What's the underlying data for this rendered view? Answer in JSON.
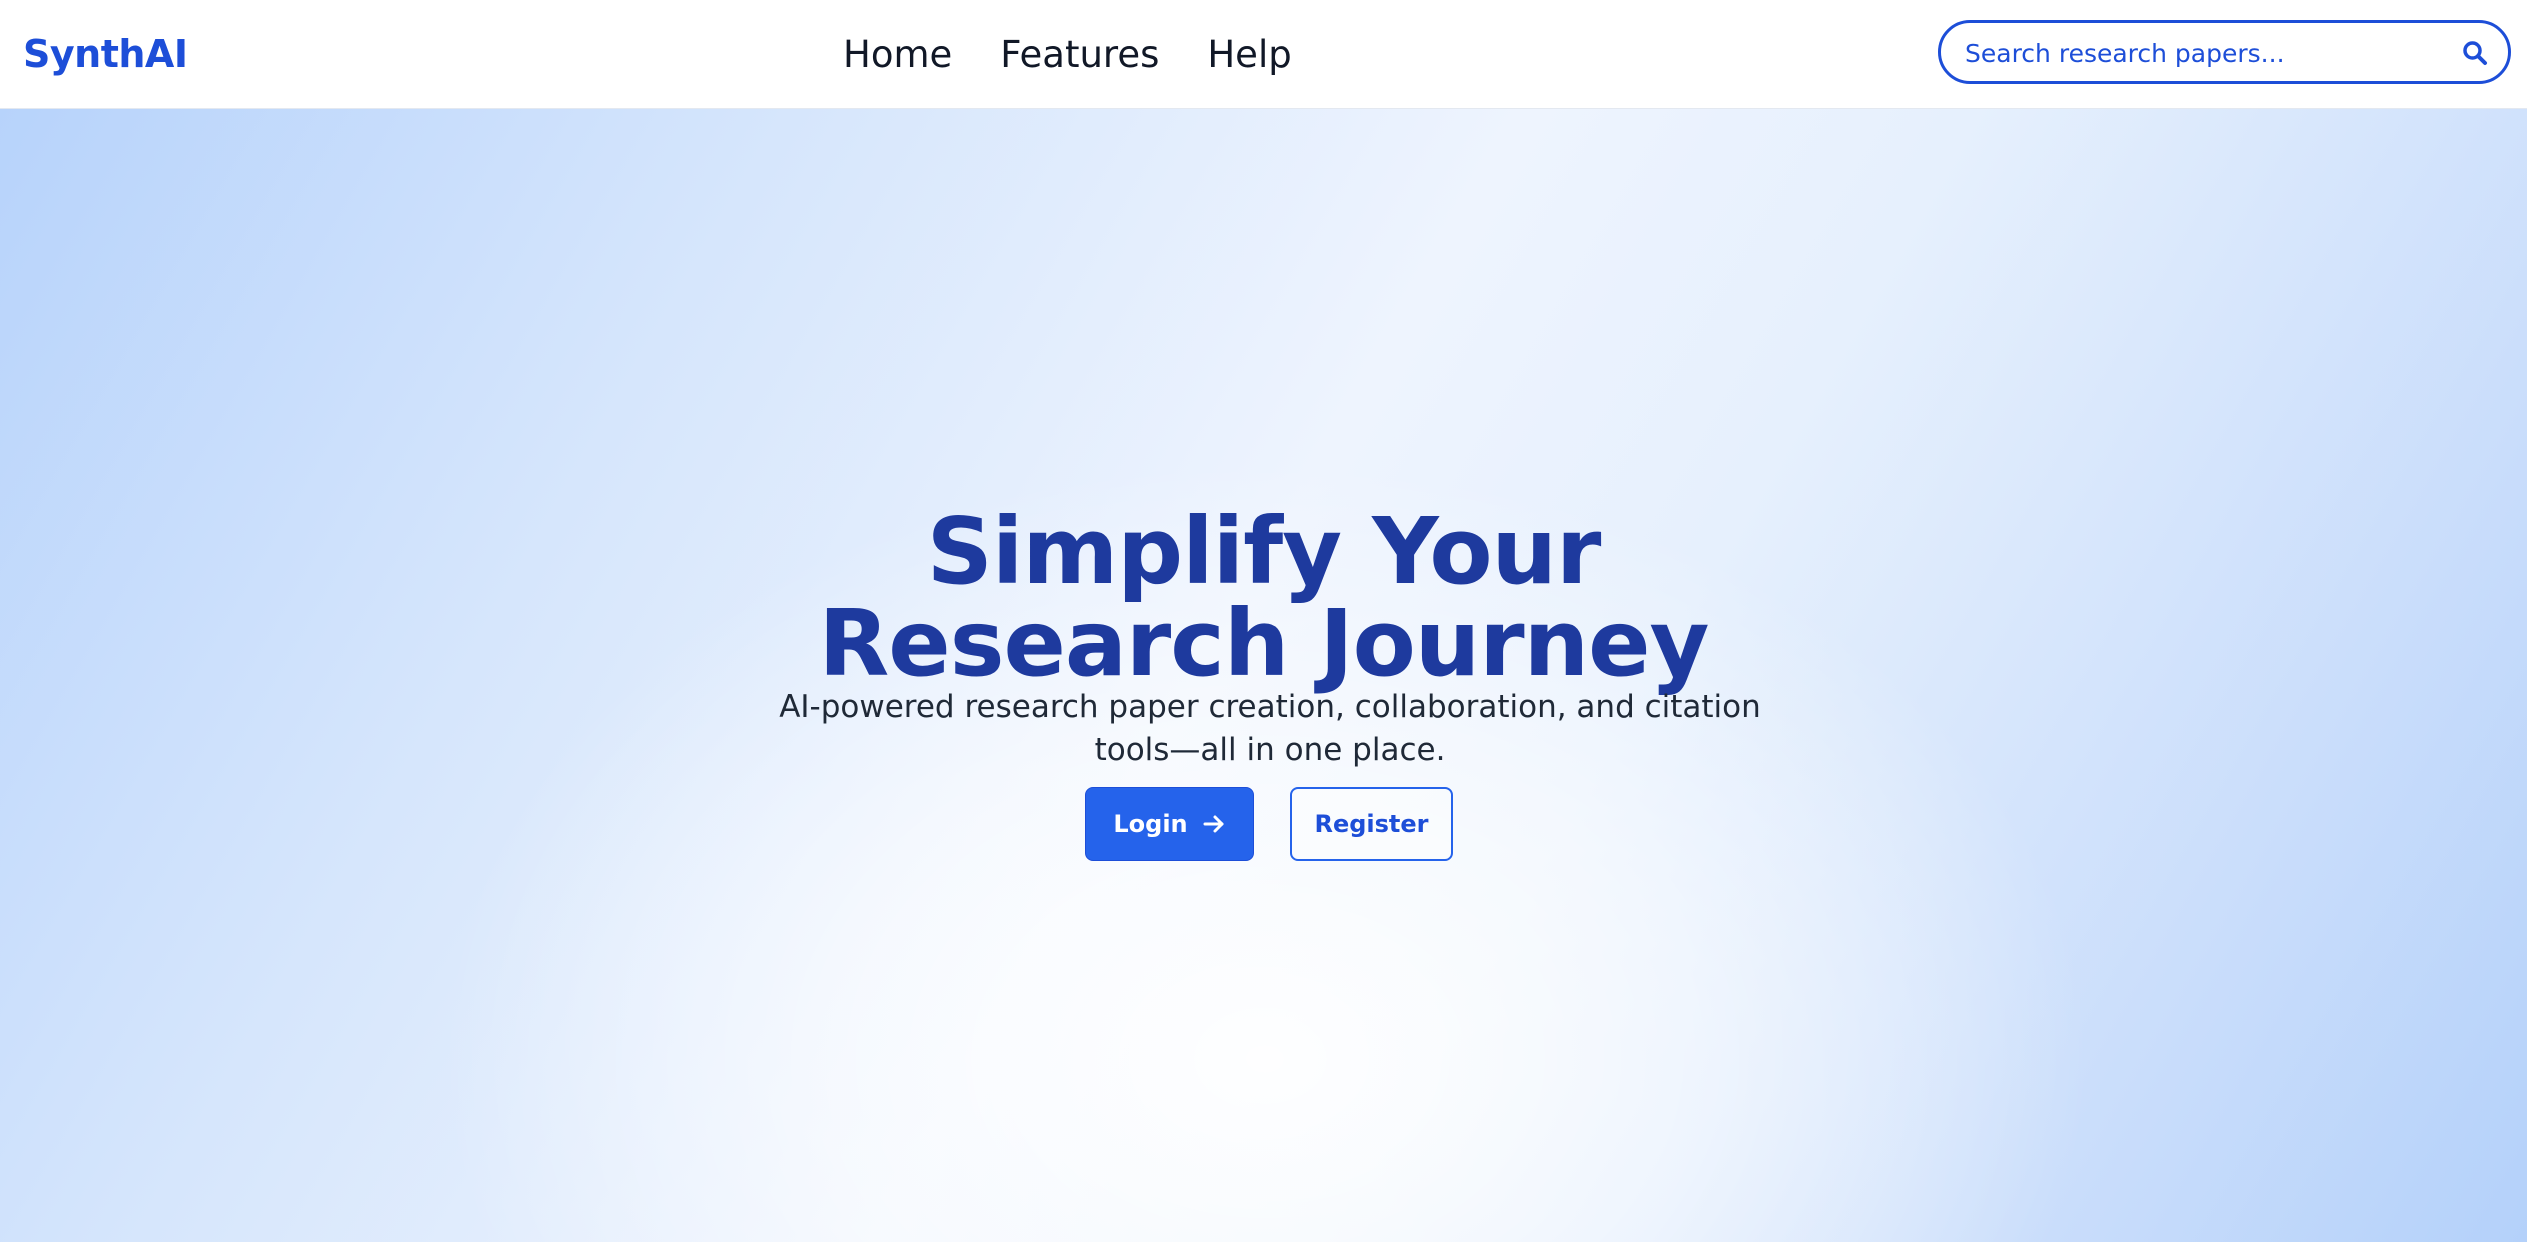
{
  "header": {
    "logo": "SynthAI",
    "nav": [
      {
        "label": "Home"
      },
      {
        "label": "Features"
      },
      {
        "label": "Help"
      }
    ],
    "search": {
      "placeholder": "Search research papers...",
      "icon": "search-icon"
    }
  },
  "hero": {
    "title_line1": "Simplify Your",
    "title_line2": "Research Journey",
    "subtitle": "AI-powered research paper creation, collaboration, and citation tools—all in one place.",
    "login_label": "Login",
    "login_icon": "arrow-right-icon",
    "register_label": "Register"
  },
  "colors": {
    "brand": "#1d4ed8",
    "title": "#1e3a9e",
    "primary_button": "#2563eb"
  }
}
